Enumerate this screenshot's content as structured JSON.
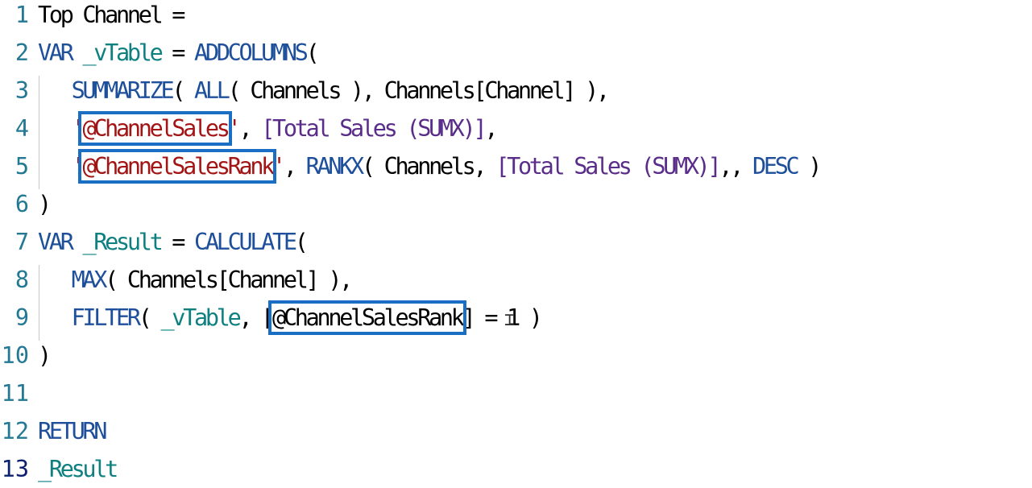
{
  "editor": {
    "active_line": 13,
    "highlight_color": "#1a6fc4",
    "lines": [
      {
        "num": "1",
        "tokens": [
          {
            "t": "Top Channel =",
            "c": "plain"
          }
        ]
      },
      {
        "num": "2",
        "tokens": [
          {
            "t": "VAR",
            "c": "kw"
          },
          {
            "t": " ",
            "c": "plain"
          },
          {
            "t": "_vTable",
            "c": "var"
          },
          {
            "t": " = ",
            "c": "plain"
          },
          {
            "t": "ADDCOLUMNS",
            "c": "fn"
          },
          {
            "t": "(",
            "c": "plain"
          }
        ]
      },
      {
        "num": "3",
        "tokens": [
          {
            "t": "   ",
            "c": "plain"
          },
          {
            "t": "SUMMARIZE",
            "c": "fn"
          },
          {
            "t": "( ",
            "c": "plain"
          },
          {
            "t": "ALL",
            "c": "fn"
          },
          {
            "t": "( Channels ), Channels[Channel] ),",
            "c": "plain"
          }
        ]
      },
      {
        "num": "4",
        "tokens": [
          {
            "t": "   ",
            "c": "plain"
          },
          {
            "t": "'",
            "c": "str"
          },
          {
            "t": "@ChannelSales",
            "c": "str",
            "hl": true
          },
          {
            "t": "'",
            "c": "str"
          },
          {
            "t": ", ",
            "c": "plain"
          },
          {
            "t": "[Total Sales (SUMX)]",
            "c": "meas"
          },
          {
            "t": ",",
            "c": "plain"
          }
        ]
      },
      {
        "num": "5",
        "tokens": [
          {
            "t": "   ",
            "c": "plain"
          },
          {
            "t": "'",
            "c": "str"
          },
          {
            "t": "@ChannelSalesRank",
            "c": "str",
            "hl": true
          },
          {
            "t": "'",
            "c": "str"
          },
          {
            "t": ", ",
            "c": "plain"
          },
          {
            "t": "RANKX",
            "c": "fn"
          },
          {
            "t": "( Channels, ",
            "c": "plain"
          },
          {
            "t": "[Total Sales (SUMX)]",
            "c": "meas"
          },
          {
            "t": ",, ",
            "c": "plain"
          },
          {
            "t": "DESC",
            "c": "kw"
          },
          {
            "t": " )",
            "c": "plain"
          }
        ]
      },
      {
        "num": "6",
        "tokens": [
          {
            "t": ")",
            "c": "plain"
          }
        ]
      },
      {
        "num": "7",
        "tokens": [
          {
            "t": "VAR",
            "c": "kw"
          },
          {
            "t": " ",
            "c": "plain"
          },
          {
            "t": "_Result",
            "c": "var"
          },
          {
            "t": " = ",
            "c": "plain"
          },
          {
            "t": "CALCULATE",
            "c": "fn"
          },
          {
            "t": "(",
            "c": "plain"
          }
        ]
      },
      {
        "num": "8",
        "tokens": [
          {
            "t": "   ",
            "c": "plain"
          },
          {
            "t": "MAX",
            "c": "fn"
          },
          {
            "t": "( Channels[Channel] ),",
            "c": "plain"
          }
        ]
      },
      {
        "num": "9",
        "tokens": [
          {
            "t": "   ",
            "c": "plain"
          },
          {
            "t": "FILTER",
            "c": "fn"
          },
          {
            "t": "( ",
            "c": "plain"
          },
          {
            "t": "_vTable",
            "c": "var"
          },
          {
            "t": ", [",
            "c": "plain"
          },
          {
            "t": "@ChannelSalesRank",
            "c": "plain",
            "hl": true
          },
          {
            "t": "] = 1 )",
            "c": "plain"
          }
        ]
      },
      {
        "num": "10",
        "tokens": [
          {
            "t": ")",
            "c": "plain"
          }
        ]
      },
      {
        "num": "11",
        "tokens": []
      },
      {
        "num": "12",
        "tokens": [
          {
            "t": "RETURN",
            "c": "kw"
          }
        ]
      },
      {
        "num": "13",
        "tokens": [
          {
            "t": "_Result",
            "c": "var"
          }
        ]
      }
    ]
  }
}
